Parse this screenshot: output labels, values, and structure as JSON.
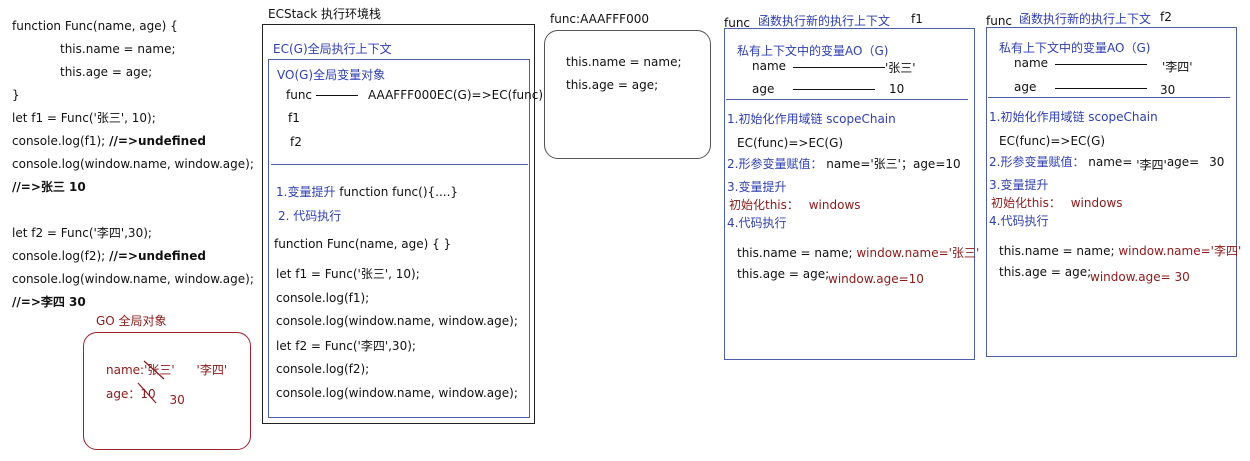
{
  "code": {
    "lines": [
      "function Func(name, age) {",
      "this.name = name;",
      "this.age = age;",
      "}",
      "let f1 = Func('张三', 10);",
      "console.log(f1);",
      "//=>undefined",
      "console.log(window.name, window.age);",
      "//=>张三 10",
      "let f2 = Func('李四',30);",
      "console.log(f2);",
      "//=>undefined",
      "console.log(window.name, window.age);",
      "//=>李四 30"
    ]
  },
  "go": {
    "title": "GO 全局对象",
    "name_label": "name:",
    "name_old": "'张三'",
    "name_new": "'李四'",
    "age_label": "age：",
    "age_old": "10",
    "age_new": "30"
  },
  "ecstack": {
    "title": "ECStack 执行环境栈",
    "ecg_title": "EC(G)全局执行上下文",
    "vog_title": "VO(G)全局变量对象",
    "func_var": "func",
    "func_value": "AAAFFF000EC(G)=>EC(func)",
    "f1_var": "f1",
    "f2_var": "f2",
    "step1": "1.变量提升",
    "step1_code": "function func(){....}",
    "step2": "2. 代码执行",
    "code_lines": [
      "function Func(name, age) {     }",
      "let f1 = Func('张三', 10);",
      "console.log(f1);",
      "console.log(window.name, window.age);",
      "let f2 = Func('李四',30);",
      "console.log(f2);",
      "console.log(window.name, window.age);"
    ]
  },
  "heap": {
    "title": "func:AAAFFF000",
    "lines": [
      "this.name = name;",
      "this.age = age;"
    ]
  },
  "ctx1": {
    "func_label": "func",
    "title": "函数执行新的执行上下文",
    "tag": "f1",
    "ao_title": "私有上下文中的变量AO（G)",
    "name_label": "name",
    "name_value": "'张三'",
    "age_label": "age",
    "age_value": "10",
    "scope_title": "1.初始化作用域链 scopeChain",
    "scope_value": "EC(func)=>EC(G)",
    "assign_title": "2.形参变量赋值：",
    "assign_value": "name='张三'；age=10",
    "hoist_title": "3.变量提升",
    "this_title": "初始化this：",
    "this_value": "windows",
    "exec_title": "4.代码执行",
    "exec_line1": "this.name = name;",
    "exec_note1": "window.name='张三'",
    "exec_line2": "this.age = age;",
    "exec_note2": "window.age=10"
  },
  "ctx2": {
    "func_label": "func",
    "title": "函数执行新的执行上下文",
    "tag": "f2",
    "ao_title": "私有上下文中的变量AO（G)",
    "name_label": "name",
    "name_value": "'李四'",
    "age_label": "age",
    "age_value": "30",
    "scope_title": "1.初始化作用域链 scopeChain",
    "scope_value": "EC(func)=>EC(G)",
    "assign_title": "2.形参变量赋值：",
    "assign_name": "name=",
    "assign_name_value": "'李四'",
    "assign_age": "age=",
    "assign_age_value": "30",
    "hoist_title": "3.变量提升",
    "this_title": "初始化this：",
    "this_value": "windows",
    "exec_title": "4.代码执行",
    "exec_line1": "this.name = name;",
    "exec_note1": "window.name='李四'",
    "exec_line2": "this.age = age;",
    "exec_note2": "window.age= 30"
  }
}
